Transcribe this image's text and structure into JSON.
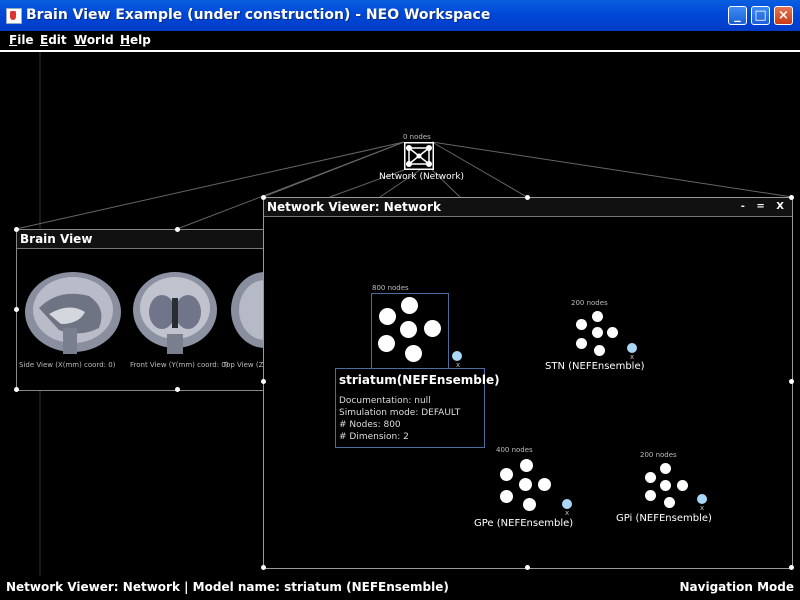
{
  "window": {
    "title": "Brain View Example (under construction) - NEO Workspace"
  },
  "menu": [
    "File",
    "Edit",
    "World",
    "Help"
  ],
  "network_node": {
    "count": "0 nodes",
    "label": "Network (Network)"
  },
  "brain_view": {
    "title": "Brain View",
    "captions": [
      "Side View (X(mm) coord: 0)",
      "Front View (Y(mm) coord: 0)",
      "Top View (Z("
    ]
  },
  "network_viewer": {
    "title": "Network Viewer: Network",
    "controls": "- = X",
    "ensembles": [
      {
        "count": "800 nodes",
        "label": "striatum(NEFEnsemble)"
      },
      {
        "count": "200 nodes",
        "label": "STN (NEFEnsemble)"
      },
      {
        "count": "400 nodes",
        "label": "GPe (NEFEnsemble)"
      },
      {
        "count": "200 nodes",
        "label": "GPi (NEFEnsemble)"
      }
    ],
    "terminal_mark": "x"
  },
  "tooltip": {
    "title": "striatum(NEFEnsemble)",
    "lines": [
      "Documentation: null",
      "Simulation mode: DEFAULT",
      "# Nodes: 800",
      "# Dimension: 2"
    ]
  },
  "status": {
    "left": "Network Viewer: Network | Model name: striatum (NEFEnsemble)",
    "right": "Navigation Mode"
  },
  "colors": {
    "titlebar": "#0048d8",
    "terminal": "#a9d7f5",
    "selection": "#4c6ba0"
  }
}
